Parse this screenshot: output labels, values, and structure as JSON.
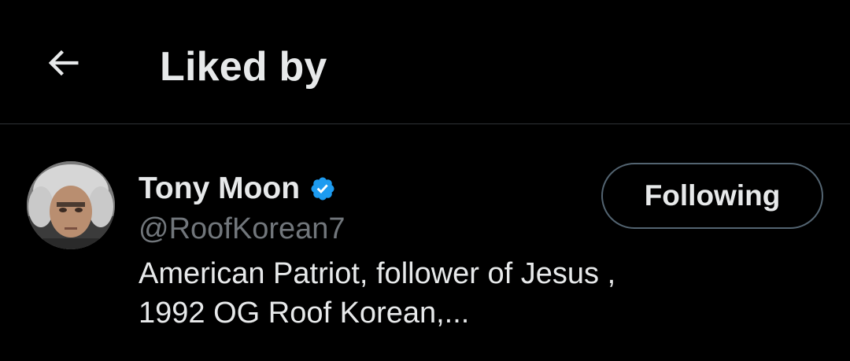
{
  "header": {
    "back_icon": "arrow-left-icon",
    "title": "Liked by"
  },
  "user": {
    "avatar_icon": "avatar-photo",
    "name": "Tony Moon",
    "verified_icon": "verified-badge-icon",
    "handle": "@RoofKorean7",
    "bio_line1": "American Patriot, follower of Jesus ,",
    "bio_line2": "1992 OG Roof Korean,...",
    "follow_label": "Following"
  },
  "colors": {
    "background": "#000000",
    "text_primary": "#e7e9ea",
    "text_secondary": "#71767b",
    "border": "#2f3336",
    "verified": "#1d9bf0"
  }
}
